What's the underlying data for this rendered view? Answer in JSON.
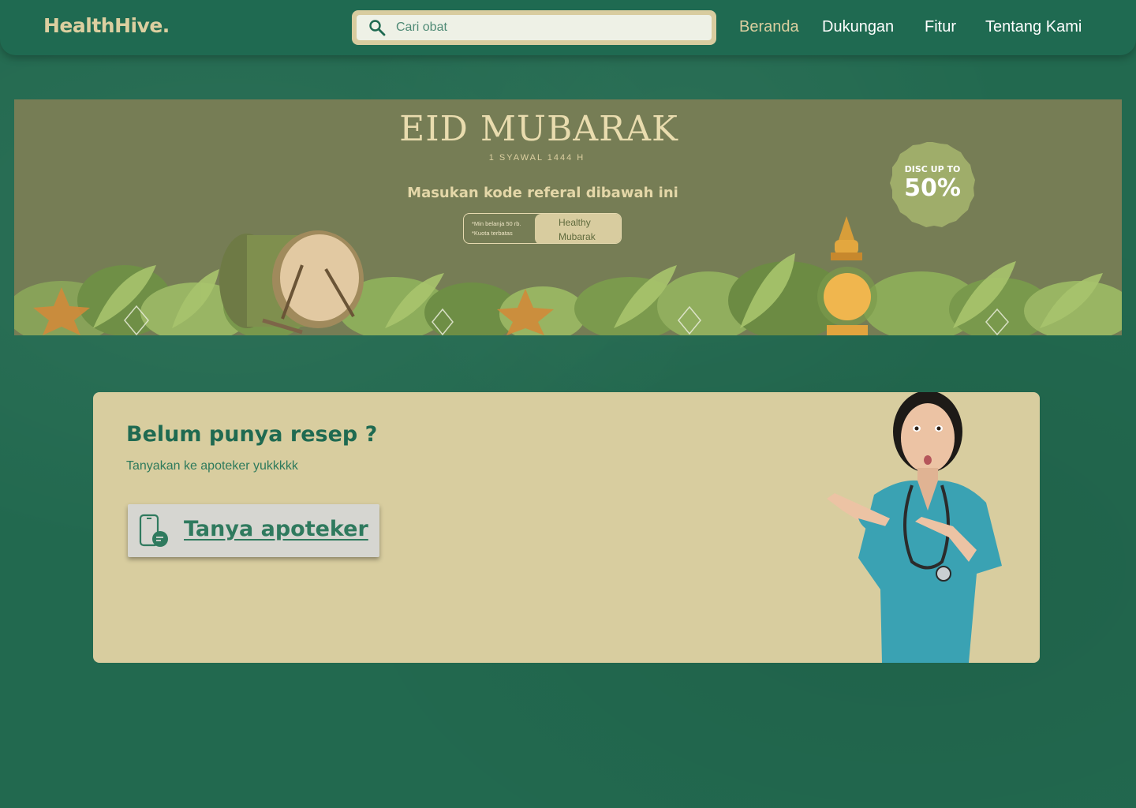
{
  "header": {
    "logo": "HealthHive.",
    "search_placeholder": "Cari obat",
    "nav": [
      {
        "label": "Beranda",
        "active": true
      },
      {
        "label": "Dukungan",
        "active": false
      },
      {
        "label": "Fitur",
        "active": false
      },
      {
        "label": "Tentang Kami",
        "active": false
      }
    ]
  },
  "banner": {
    "title": "EID MUBARAK",
    "date": "1 SYAWAL 1444 H",
    "subtitle": "Masukan kode referal dibawah ini",
    "note_1": "*Min belanja 50 rb.",
    "note_2": "*Kuota terbatas",
    "code_line_1": "Healthy",
    "code_line_2": "Mubarak",
    "discount_label": "DISC UP TO",
    "discount_value": "50%"
  },
  "consult": {
    "title": "Belum punya resep ?",
    "subtitle": "Tanyakan ke apoteker yukkkkk",
    "button_label": "Tanya apoteker"
  },
  "colors": {
    "background": "#22694f",
    "navbar": "#1f6a51",
    "accent_beige": "#d8cd9f",
    "banner_olive": "#767d55",
    "text_green": "#1f6a51"
  },
  "icons": {
    "search": "search-icon",
    "ask": "phone-chat-icon"
  }
}
